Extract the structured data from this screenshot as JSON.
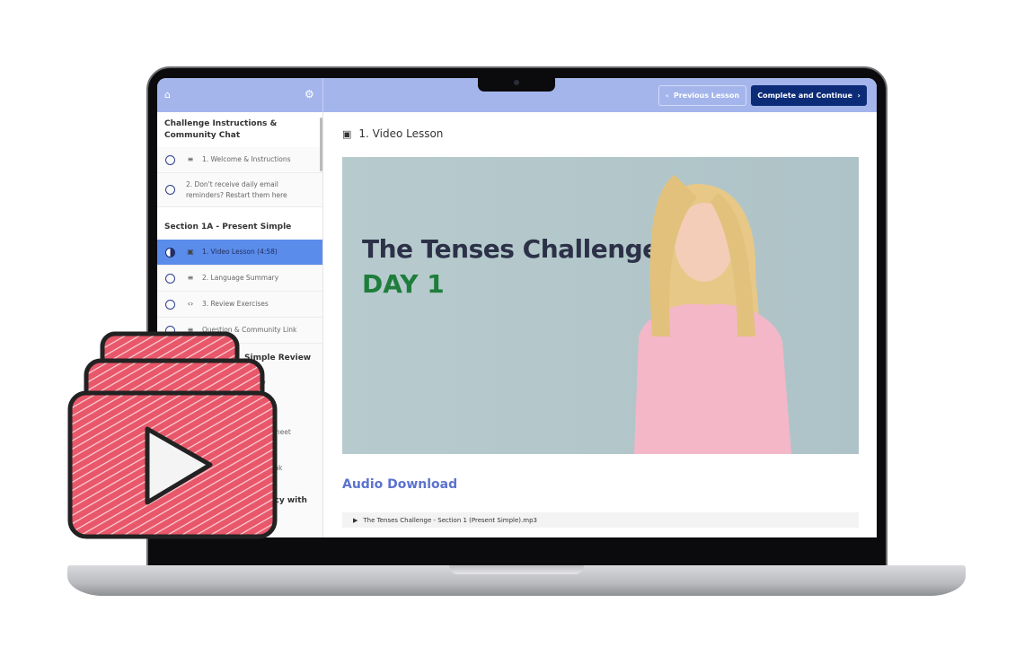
{
  "topbar": {
    "home_icon": "home-icon",
    "settings_icon": "gear-icon",
    "prev_label": "Previous Lesson",
    "next_label": "Complete and Continue"
  },
  "sidebar": {
    "section1": "Challenge Instructions & Community Chat",
    "s1_items": [
      {
        "label": "1. Welcome & Instructions",
        "icon": "text-lines-icon"
      },
      {
        "label": "2. Don't receive daily email reminders? Restart them here",
        "icon": "text-lines-icon"
      }
    ],
    "section2": "Section 1A - Present Simple",
    "s2_items": [
      {
        "label": "1. Video Lesson (4:58)",
        "icon": "video-icon",
        "active": true
      },
      {
        "label": "2. Language Summary",
        "icon": "text-lines-icon"
      },
      {
        "label": "3. Review Exercises",
        "icon": "code-icon"
      },
      {
        "label": "Question & Community Link",
        "icon": "text-lines-icon"
      }
    ],
    "section3_partial": "Simple Review",
    "s3_partials": [
      "ew",
      "t's meet",
      "Link"
    ],
    "section4_partial": "ency with"
  },
  "main": {
    "lesson_title": "1. Video Lesson",
    "video_title": "The Tenses Challenge",
    "video_subtitle": "DAY 1",
    "audio_heading": "Audio Download",
    "audio_file": "The Tenses Challenge - Section 1 (Present Simple).mp3"
  },
  "colors": {
    "topbar": "#a4b5ec",
    "active": "#5a8ceb",
    "primary_button": "#0c2c78",
    "day_green": "#1f7d3c",
    "overlay_red": "#e8576a"
  }
}
